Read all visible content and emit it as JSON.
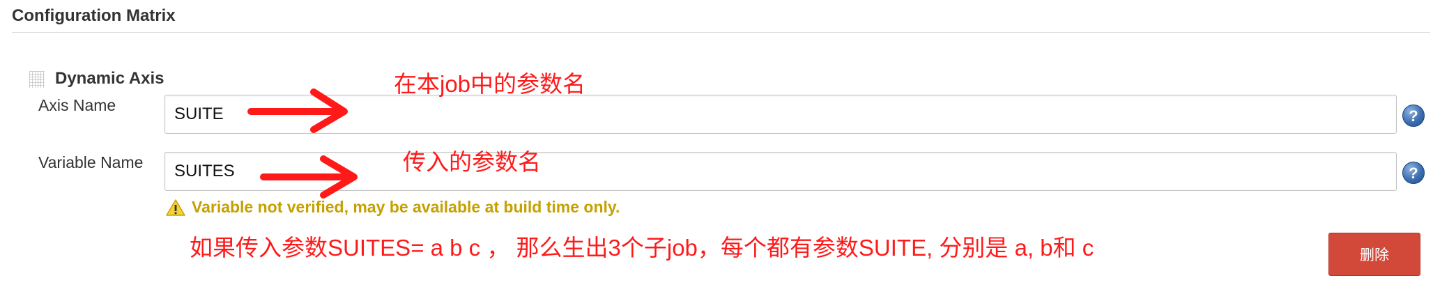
{
  "section": {
    "title": "Configuration Matrix"
  },
  "axis": {
    "heading": "Dynamic Axis",
    "axis_name_label": "Axis Name",
    "axis_name_value": "SUITE",
    "variable_name_label": "Variable Name",
    "variable_name_value": "SUITES",
    "help_label": "?",
    "warning_text": "Variable not verified, may be available at build time only.",
    "delete_label": "删除"
  },
  "annotations": {
    "axis_name_note": "在本job中的参数名",
    "variable_name_note": "传入的参数名",
    "explanation": "如果传入参数SUITES= a b c  ，  那么生出3个子job，每个都有参数SUITE, 分别是 a, b和 c"
  },
  "colors": {
    "annotation": "#ff1a1a",
    "warning": "#c4a000",
    "delete_button": "#d24939",
    "help_icon": "#3d6fb0"
  },
  "icons": {
    "drag": "drag-handle-icon",
    "help": "help-icon",
    "warning": "warning-icon",
    "arrow": "red-arrow-icon"
  }
}
